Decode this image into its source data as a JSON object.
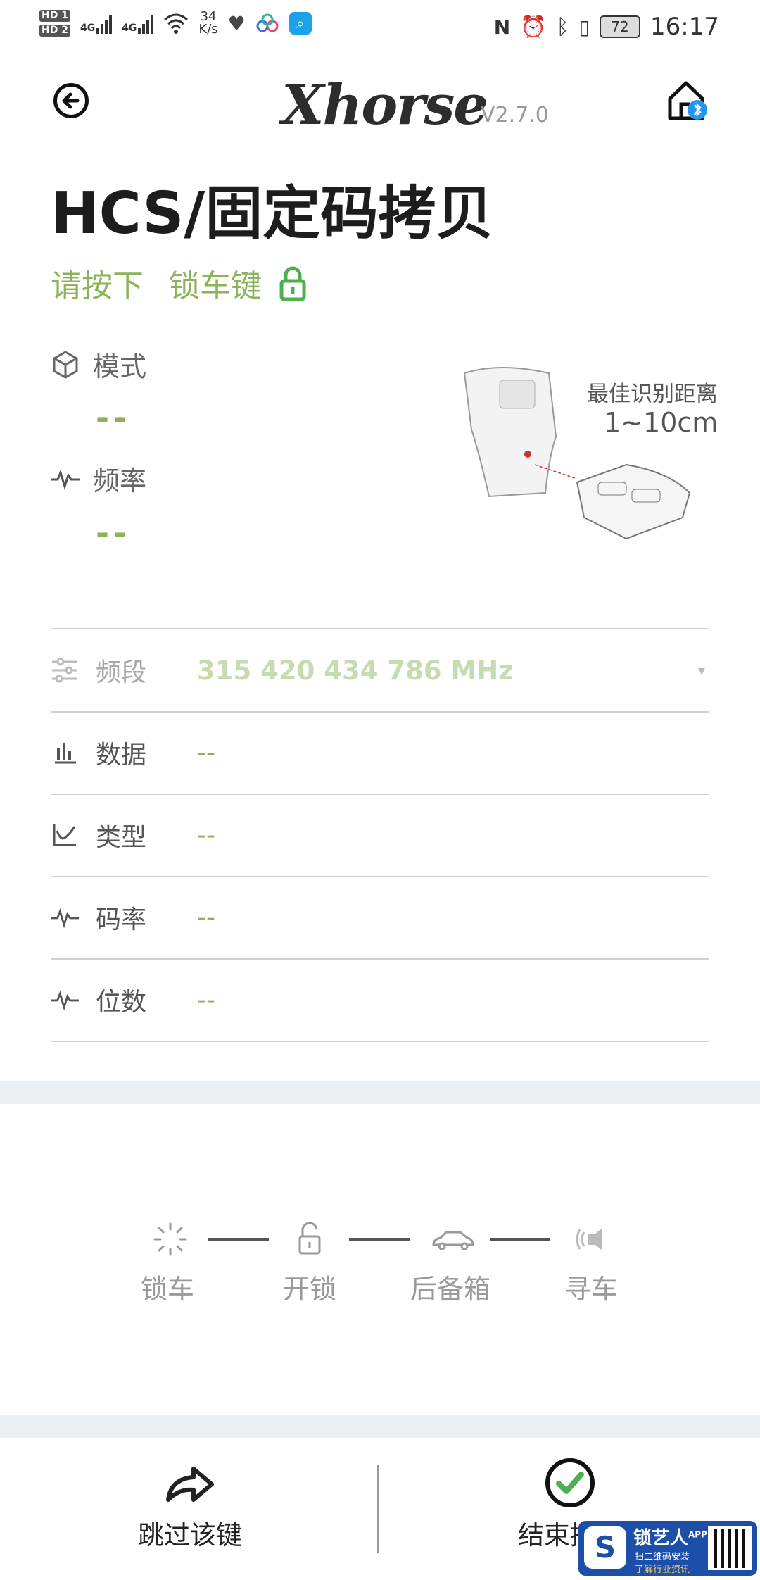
{
  "status_bar": {
    "hd1": "HD 1",
    "hd2": "HD 2",
    "net1": "4G",
    "net2": "4G",
    "speed_value": "34",
    "speed_unit": "K/s",
    "battery": "72",
    "time": "16:17"
  },
  "header": {
    "logo_text": "Xhorse",
    "version": "V2.7.0"
  },
  "page": {
    "title": "HCS/固定码拷贝",
    "instruction_prefix": "请按下",
    "instruction_key": "锁车键"
  },
  "params": {
    "mode_label": "模式",
    "mode_value": "--",
    "freq_label": "频率",
    "freq_value": "--"
  },
  "distance": {
    "title": "最佳识别距离",
    "value": "1~10cm"
  },
  "rows": [
    {
      "label": "频段",
      "value": "315 420 434 786 MHz"
    },
    {
      "label": "数据",
      "value": "--"
    },
    {
      "label": "类型",
      "value": "--"
    },
    {
      "label": "码率",
      "value": "--"
    },
    {
      "label": "位数",
      "value": "--"
    }
  ],
  "steps": [
    {
      "label": "锁车"
    },
    {
      "label": "开锁"
    },
    {
      "label": "后备箱"
    },
    {
      "label": "寻车"
    }
  ],
  "bottom": {
    "skip_label": "跳过该键",
    "finish_label": "结束拷贝"
  },
  "watermark": {
    "brand": "锁艺人",
    "app": "APP",
    "line1": "扫二维码安装",
    "line2": "了解行业资讯"
  },
  "colors": {
    "accent_green": "#8db35a",
    "lock_icon_green": "#4caf50"
  }
}
